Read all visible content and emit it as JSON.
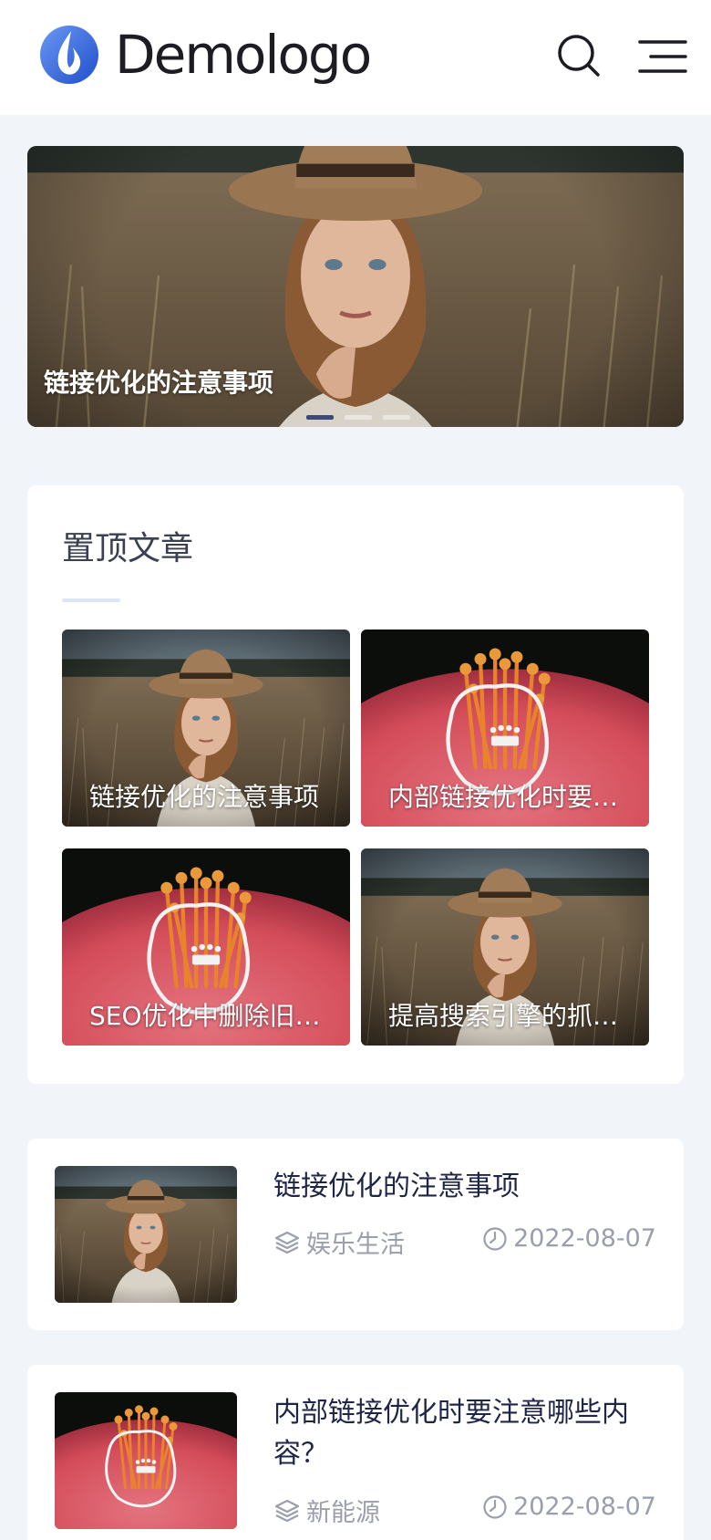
{
  "header": {
    "logo_text": "Demologo",
    "brand_color": "#3b6fe0",
    "search_icon": "search-icon",
    "menu_icon": "menu-icon"
  },
  "banner": {
    "caption": "链接优化的注意事项",
    "slide_count": 3,
    "active_slide": 1
  },
  "pinned": {
    "title": "置顶文章",
    "items": [
      {
        "caption": "链接优化的注意事项",
        "image": "woman-hat-photo"
      },
      {
        "caption": "内部链接优化时要注意哪些内容？",
        "image": "pink-flower-photo"
      },
      {
        "caption": "SEO优化中删除旧文章对网站的影响",
        "image": "pink-flower-photo"
      },
      {
        "caption": "提高搜索引擎的抓取频率",
        "image": "woman-hat-photo"
      }
    ]
  },
  "articles": [
    {
      "title": "链接优化的注意事项",
      "category": "娱乐生活",
      "date": "2022-08-07",
      "image": "woman-hat-photo"
    },
    {
      "title": "内部链接优化时要注意哪些内容？",
      "category": "新能源",
      "date": "2022-08-07",
      "image": "pink-flower-photo"
    }
  ],
  "icons": {
    "category": "layers-icon",
    "date": "clock-icon"
  }
}
